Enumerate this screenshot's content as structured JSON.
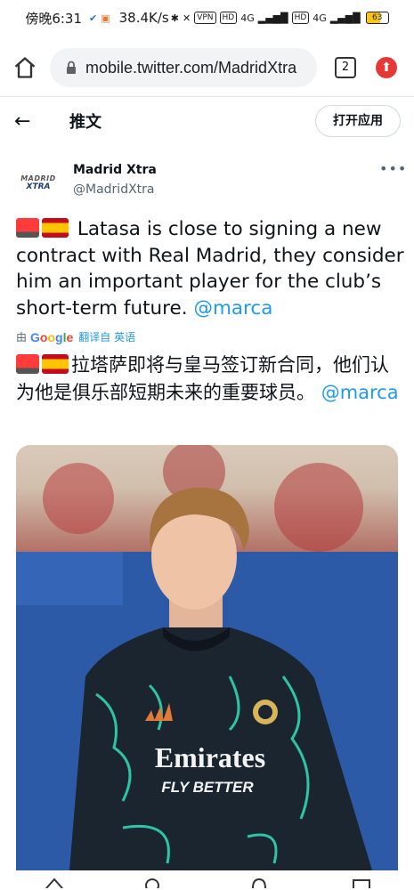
{
  "status_bar": {
    "time": "傍晚6:31",
    "speed": "38.4K/s",
    "vpn": "VPN",
    "hd1": "HD",
    "net1": "4G",
    "hd2": "HD",
    "net2": "4G",
    "battery": "63"
  },
  "browser": {
    "url": "mobile.twitter.com/MadridXtra",
    "tab_count": "2"
  },
  "header": {
    "title": "推文",
    "open_app": "打开应用"
  },
  "tweet": {
    "avatar_line1": "MADRID",
    "avatar_line2": "XTRA",
    "author_name": "Madrid Xtra",
    "author_handle": "@MadridXtra",
    "text": "Latasa is close to signing a new contract with Real Madrid, they consider him an important player for the club’s short-term future.",
    "mention": "@marca",
    "translate_prefix": "由",
    "translate_suffix": "翻译自 英语",
    "translated_text": "拉塔萨即将与皇马签订新合同，他们认为他是俱乐部短期未来的重要球员。",
    "translated_mention": "@marca"
  },
  "photo": {
    "sponsor_line1": "Emirates",
    "sponsor_line2": "FLY BETTER",
    "kit_brand": "adidas"
  },
  "colors": {
    "accent": "#1d9bf0",
    "kit_green": "#2ec4a6",
    "kit_dark": "#1a2530"
  }
}
